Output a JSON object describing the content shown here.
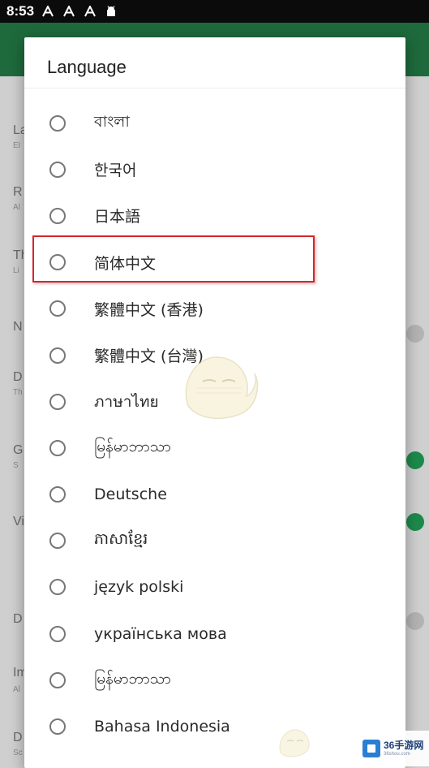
{
  "status_bar": {
    "time": "8:53",
    "icons": [
      "a-notification-icon",
      "a-notification-icon",
      "a-notification-icon",
      "android-icon"
    ]
  },
  "background": {
    "rows": [
      {
        "label": "La",
        "sub": "El"
      },
      {
        "label": "R",
        "sub": "Al"
      },
      {
        "label": "Th",
        "sub": "Li"
      },
      {
        "label": "N",
        "sub": ""
      },
      {
        "label": "D",
        "sub": "Th"
      },
      {
        "label": "G",
        "sub": "S"
      },
      {
        "label": "Vi",
        "sub": ""
      },
      {
        "label": "D",
        "sub": ""
      },
      {
        "label": "Im",
        "sub": "Al"
      },
      {
        "label": "D",
        "sub": "Sc"
      }
    ],
    "accent": "#1e6a3c",
    "toggle_on_color": "#1c8a4a"
  },
  "dialog": {
    "title": "Language",
    "options": [
      {
        "label": "বাংলা",
        "selected": false
      },
      {
        "label": "한국어",
        "selected": false
      },
      {
        "label": "日本語",
        "selected": false
      },
      {
        "label": "简体中文",
        "selected": false,
        "highlighted": true
      },
      {
        "label": "繁體中文 (香港)",
        "selected": false
      },
      {
        "label": "繁體中文 (台灣)",
        "selected": false
      },
      {
        "label": "ภาษาไทย",
        "selected": false
      },
      {
        "label": "မြန်မာဘာသာ",
        "selected": false
      },
      {
        "label": "Deutsche",
        "selected": false
      },
      {
        "label": "ភាសាខ្មែរ",
        "selected": false
      },
      {
        "label": "język polski",
        "selected": false
      },
      {
        "label": "українська мова",
        "selected": false
      },
      {
        "label": "မြန်မာဘာသာ",
        "selected": false
      },
      {
        "label": "Bahasa Indonesia",
        "selected": false
      }
    ],
    "highlight_color": "#d6262b"
  },
  "watermark": {
    "brand": "36手游网",
    "site": "36shou.com"
  }
}
